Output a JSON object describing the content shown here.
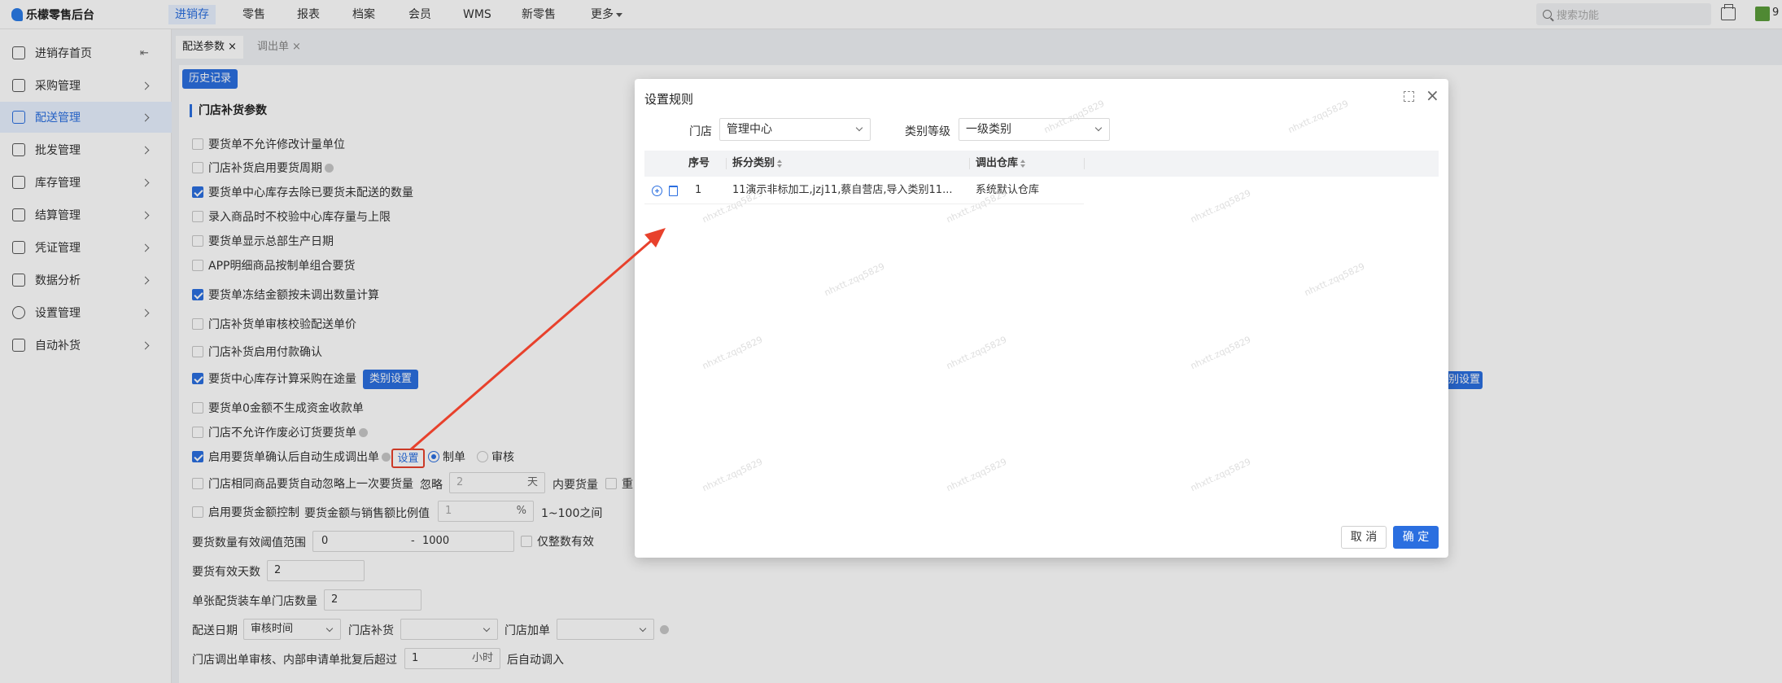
{
  "topbar": {
    "logo": "乐檬零售后台",
    "nav": [
      "进销存",
      "零售",
      "报表",
      "档案",
      "会员",
      "WMS",
      "新零售",
      "更多"
    ],
    "search_placeholder": "搜索功能",
    "user_initial": "9"
  },
  "sidebar": {
    "items": [
      {
        "label": "进销存首页",
        "icon": "home-icon"
      },
      {
        "label": "采购管理",
        "icon": "cart-icon"
      },
      {
        "label": "配送管理",
        "icon": "truck-icon"
      },
      {
        "label": "批发管理",
        "icon": "box-icon"
      },
      {
        "label": "库存管理",
        "icon": "inventory-icon"
      },
      {
        "label": "结算管理",
        "icon": "dollar-icon"
      },
      {
        "label": "凭证管理",
        "icon": "document-icon"
      },
      {
        "label": "数据分析",
        "icon": "chart-icon"
      },
      {
        "label": "设置管理",
        "icon": "gear-icon"
      },
      {
        "label": "自动补货",
        "icon": "robot-icon"
      }
    ]
  },
  "tabs": [
    {
      "label": "配送参数",
      "active": true
    },
    {
      "label": "调出单",
      "active": false
    }
  ],
  "page": {
    "history_button": "历史记录",
    "section_title": "门店补货参数",
    "options": [
      {
        "label": "要货单不允许修改计量单位",
        "checked": false
      },
      {
        "label": "门店补货启用要货周期",
        "checked": false,
        "help": true
      },
      {
        "label": "要货单中心库存去除已要货未配送的数量",
        "checked": true
      },
      {
        "label": "录入商品时不校验中心库存量与上限",
        "checked": false
      },
      {
        "label": "要货单显示总部生产日期",
        "checked": false
      },
      {
        "label": "APP明细商品按制单组合要货",
        "checked": false
      },
      {
        "label": "要货单冻结金额按未调出数量计算",
        "checked": true
      },
      {
        "label": "门店补货单审核校验配送单价",
        "checked": false
      },
      {
        "label": "门店补货启用付款确认",
        "checked": false
      },
      {
        "label": "要货中心库存计算采购在途量",
        "checked": true
      },
      {
        "label": "要货单0金额不生成资金收款单",
        "checked": false
      },
      {
        "label": "门店不允许作废必订货要货单",
        "checked": false,
        "help": true
      },
      {
        "label": "启用要货单确认后自动生成调出单",
        "checked": true,
        "help": true
      }
    ],
    "category_button": "类别设置",
    "settings_link": "设置",
    "radio_make": "制单",
    "radio_audit": "审核",
    "ignore_row": {
      "label": "门店相同商品要货自动忽略上一次要货量",
      "ignore": "忽略",
      "value": "2",
      "unit": "天",
      "tail": "内要货量",
      "tail2": "重"
    },
    "amount_row": {
      "label": "启用要货金额控制",
      "text": "要货金额与销售额比例值",
      "value": "1",
      "unit": "%",
      "range": "1~100之间"
    },
    "qty_range": {
      "label": "要货数量有效阈值范围",
      "min": "0",
      "sep": "-",
      "max": "1000",
      "int_only": "仅整数有效"
    },
    "valid_days": {
      "label": "要货有效天数",
      "value": "2"
    },
    "single_count": {
      "label": "单张配货装车单门店数量",
      "value": "2"
    },
    "delivery": {
      "label": "配送日期",
      "value": "审核时间",
      "store_replenish": "门店补货",
      "store_add": "门店加单"
    },
    "auto_in": {
      "label": "门店调出单审核、内部申请单批复后超过",
      "value": "1",
      "unit": "小时",
      "tail": "后自动调入"
    },
    "right_cut_button": "别设置"
  },
  "modal": {
    "title": "设置规则",
    "store_label": "门店",
    "store_value": "管理中心",
    "level_label": "类别等级",
    "level_value": "一级类别",
    "columns": [
      "序号",
      "拆分类别",
      "调出仓库"
    ],
    "rows": [
      {
        "index": "1",
        "category": "11演示非标加工,jzj11,蔡自营店,导入类别11...",
        "warehouse": "系统默认仓库"
      }
    ],
    "cancel": "取 消",
    "ok": "确 定",
    "watermark": "nhxtt.zqq5829"
  },
  "colors": {
    "accent": "#2b6fe0",
    "annotation": "#e8412c"
  }
}
